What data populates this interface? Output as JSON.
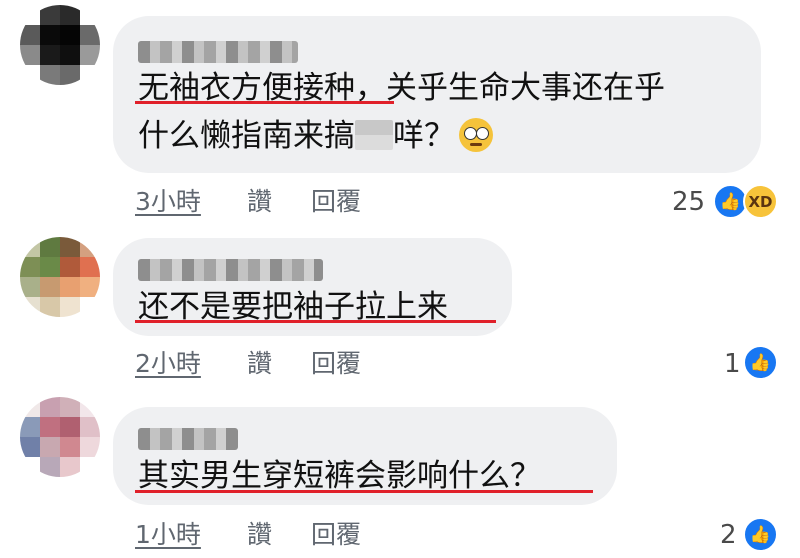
{
  "comments": [
    {
      "text_lines": [
        "无袖衣方便接种，关乎生命大事还在乎",
        "什么懒指南来搞",
        "咩？"
      ],
      "time": "3小時",
      "like_label": "讚",
      "reply_label": "回覆",
      "reaction_count": "25",
      "reactions": [
        "like",
        "haha"
      ]
    },
    {
      "text_lines": [
        "还不是要把袖子拉上来"
      ],
      "time": "2小時",
      "like_label": "讚",
      "reply_label": "回覆",
      "reaction_count": "1",
      "reactions": [
        "like"
      ]
    },
    {
      "text_lines": [
        "其实男生穿短裤会影响什么？"
      ],
      "time": "1小時",
      "like_label": "讚",
      "reply_label": "回覆",
      "reaction_count": "2",
      "reactions": [
        "like"
      ]
    }
  ],
  "colors": {
    "bubble": "#eff0f2",
    "underline": "#e0202a",
    "meta_text": "#606770",
    "like_blue": "#1877f2"
  }
}
